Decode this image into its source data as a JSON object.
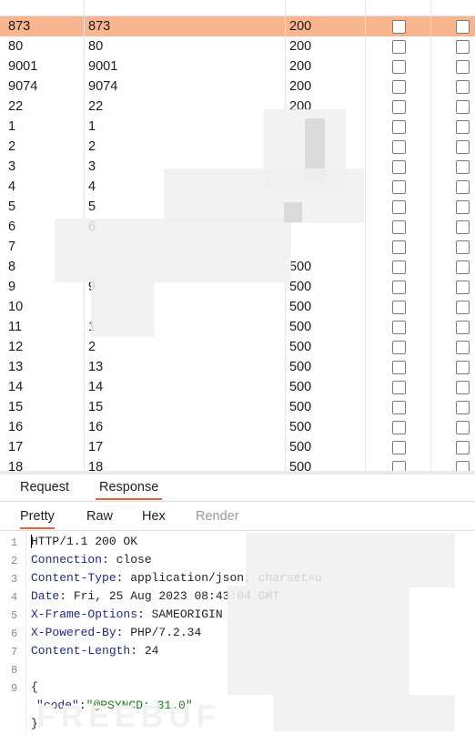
{
  "results": {
    "rows": [
      {
        "c1": "873",
        "c2": "873",
        "c3": "200",
        "selected": true
      },
      {
        "c1": "80",
        "c2": "80",
        "c3": "200"
      },
      {
        "c1": "9001",
        "c2": "9001",
        "c3": "200"
      },
      {
        "c1": "9074",
        "c2": "9074",
        "c3": "200"
      },
      {
        "c1": "22",
        "c2": "22",
        "c3": "200"
      },
      {
        "c1": "1",
        "c2": "1",
        "c3": ""
      },
      {
        "c1": "2",
        "c2": "2",
        "c3": ""
      },
      {
        "c1": "3",
        "c2": "3",
        "c3": ""
      },
      {
        "c1": "4",
        "c2": "4",
        "c3": ""
      },
      {
        "c1": "5",
        "c2": "5",
        "c3": ""
      },
      {
        "c1": "6",
        "c2": "6",
        "c3": ""
      },
      {
        "c1": "7",
        "c2": "",
        "c3": ""
      },
      {
        "c1": "8",
        "c2": "",
        "c3": "500"
      },
      {
        "c1": "9",
        "c2": "9",
        "c3": "500"
      },
      {
        "c1": "10",
        "c2": "",
        "c3": "500"
      },
      {
        "c1": "11",
        "c2": "1",
        "c3": "500"
      },
      {
        "c1": "12",
        "c2": "2",
        "c3": "500"
      },
      {
        "c1": "13",
        "c2": "13",
        "c3": "500"
      },
      {
        "c1": "14",
        "c2": "14",
        "c3": "500"
      },
      {
        "c1": "15",
        "c2": "15",
        "c3": "500"
      },
      {
        "c1": "16",
        "c2": "16",
        "c3": "500"
      },
      {
        "c1": "17",
        "c2": "17",
        "c3": "500"
      },
      {
        "c1": "18",
        "c2": "18",
        "c3": "500"
      }
    ]
  },
  "tabs": {
    "request": "Request",
    "response": "Response"
  },
  "viewTabs": {
    "pretty": "Pretty",
    "raw": "Raw",
    "hex": "Hex",
    "render": "Render"
  },
  "editor": {
    "lines": [
      {
        "n": "1",
        "key": "",
        "text": "HTTP/1.1 200 OK"
      },
      {
        "n": "2",
        "key": "Connection",
        "text": ": close"
      },
      {
        "n": "3",
        "key": "Content-Type",
        "text": ": application/json; charset=u"
      },
      {
        "n": "4",
        "key": "Date",
        "text": ": Fri, 25 Aug 2023 08:43:04 GMT"
      },
      {
        "n": "5",
        "key": "X-Frame-Options",
        "text": ": SAMEORIGIN"
      },
      {
        "n": "6",
        "key": "X-Powered-By",
        "text": ": PHP/7.2.34"
      },
      {
        "n": "7",
        "key": "Content-Length",
        "text": ": 24"
      },
      {
        "n": "8",
        "key": "",
        "text": ""
      },
      {
        "n": "9",
        "key": "",
        "text": "{"
      },
      {
        "n": "",
        "key": "",
        "text": ""
      },
      {
        "n": "",
        "key": "",
        "text": "}"
      }
    ],
    "json_key": "\"code\"",
    "json_colon": ":",
    "json_value": "\"@RSYNCD: 31.0\""
  },
  "watermark": "FREEBUF",
  "colors": {
    "selected_row": "#f8b58f",
    "accent": "#e8603a"
  }
}
